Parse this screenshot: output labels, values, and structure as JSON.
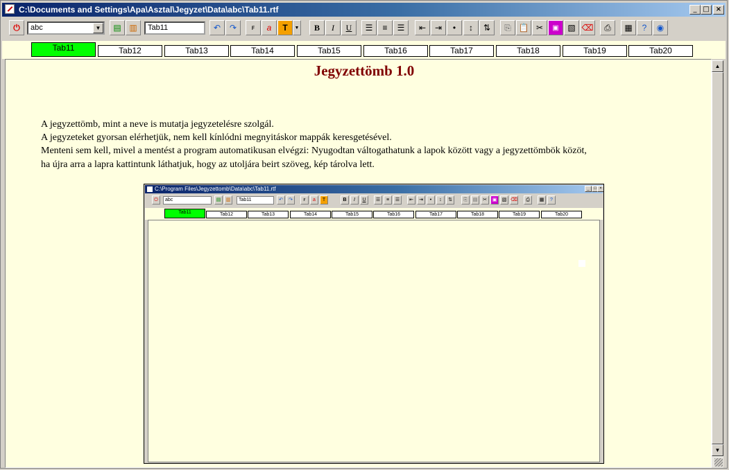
{
  "window": {
    "title": "C:\\Documents and Settings\\Apa\\Asztal\\Jegyzet\\Data\\abc\\Tab11.rtf",
    "minimize": "_",
    "maximize": "□",
    "close": "×"
  },
  "toolbar": {
    "notebook_select": "abc",
    "tab_name": "Tab11",
    "bold": "B",
    "italic": "I",
    "underline": "U",
    "text_color": "T",
    "font_color": "a"
  },
  "tabs": [
    "Tab11",
    "Tab12",
    "Tab13",
    "Tab14",
    "Tab15",
    "Tab16",
    "Tab17",
    "Tab18",
    "Tab19",
    "Tab20"
  ],
  "active_tab": "Tab11",
  "document": {
    "title": "Jegyzettömb 1.0",
    "lines": [
      "A jegyzettömb, mint a neve is mutatja jegyzetelésre szolgál.",
      "A jegyzeteket gyorsan elérhetjük, nem kell kínlódni megnyitáskor mappák keresgetésével.",
      "Menteni sem kell, mivel a mentést a program automatikusan elvégzi: Nyugodtan váltogathatunk a lapok között vagy a jegyzettömbök közöt,",
      "ha újra arra a lapra kattintunk láthatjuk, hogy az utoljára beirt szöveg, kép tárolva lett."
    ]
  },
  "embedded_screenshot": {
    "title": "C:\\Program Files\\Jegyzettomb\\Data\\abc\\Tab11.rtf",
    "notebook_select": "abc",
    "tab_name": "Tab11",
    "bold": "B",
    "italic": "I",
    "underline": "U",
    "text_color": "T"
  },
  "colors": {
    "active_tab": "#00ff00",
    "page_background": "#ffffe0",
    "title_color": "#800000"
  }
}
